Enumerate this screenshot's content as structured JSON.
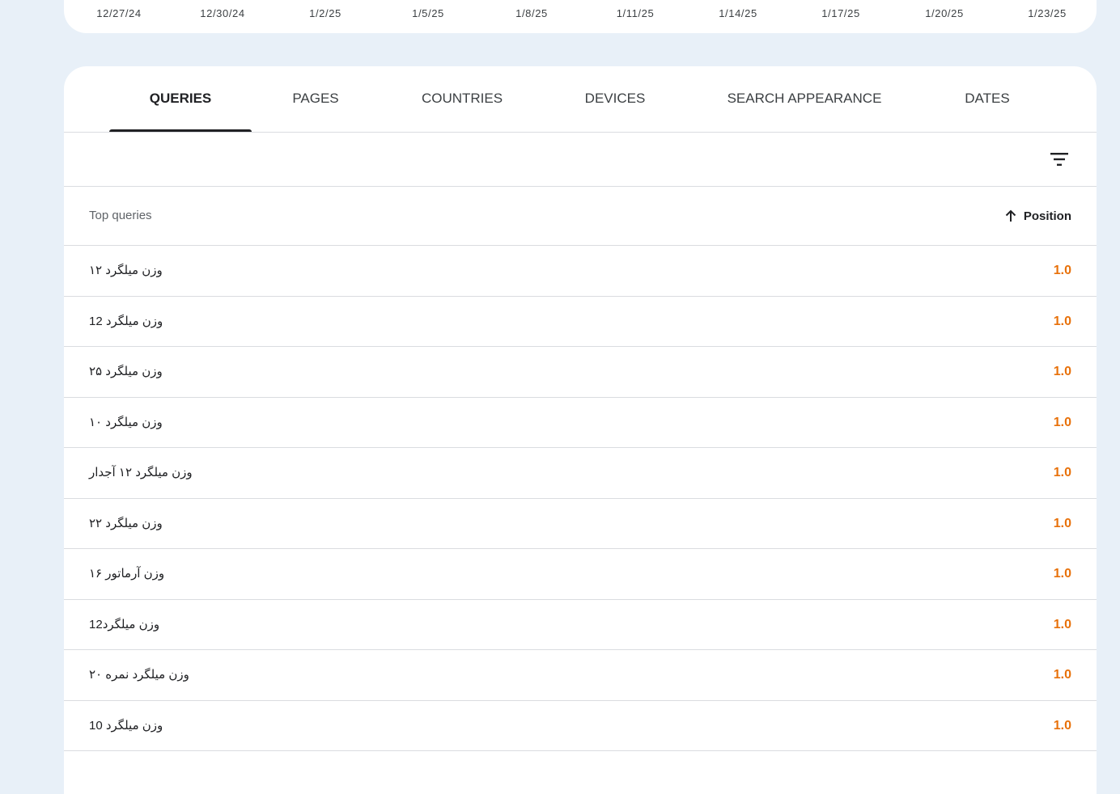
{
  "chart": {
    "date_ticks": [
      "12/27/24",
      "12/30/24",
      "1/2/25",
      "1/5/25",
      "1/8/25",
      "1/11/25",
      "1/14/25",
      "1/17/25",
      "1/20/25",
      "1/23/25"
    ]
  },
  "tabs": [
    {
      "label": "QUERIES",
      "active": true
    },
    {
      "label": "PAGES",
      "active": false
    },
    {
      "label": "COUNTRIES",
      "active": false
    },
    {
      "label": "DEVICES",
      "active": false
    },
    {
      "label": "SEARCH APPEARANCE",
      "active": false
    },
    {
      "label": "DATES",
      "active": false
    }
  ],
  "toolbar": {
    "filter_icon": "filter-list-icon"
  },
  "table": {
    "query_header": "Top queries",
    "position_header": "Position",
    "sort_icon": "arrow-upward-icon",
    "value_color": "#e8710a",
    "rows": [
      {
        "query": "وزن میلگرد ۱۲",
        "position": "1.0"
      },
      {
        "query": "وزن میلگرد 12",
        "position": "1.0"
      },
      {
        "query": "وزن میلگرد ۲۵",
        "position": "1.0"
      },
      {
        "query": "وزن میلگرد ۱۰",
        "position": "1.0"
      },
      {
        "query": "وزن میلگرد ۱۲ آجدار",
        "position": "1.0"
      },
      {
        "query": "وزن میلگرد ۲۲",
        "position": "1.0"
      },
      {
        "query": "وزن آرماتور ۱۶",
        "position": "1.0"
      },
      {
        "query": "وزن میلگرد12",
        "position": "1.0"
      },
      {
        "query": "وزن میلگرد نمره ۲۰",
        "position": "1.0"
      },
      {
        "query": "وزن میلگرد 10",
        "position": "1.0"
      }
    ]
  }
}
